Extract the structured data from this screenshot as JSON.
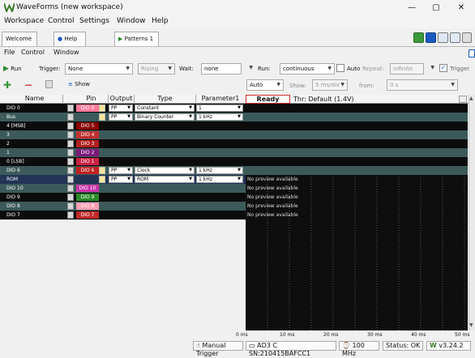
{
  "window": {
    "title": "WaveForms (new workspace)",
    "min": "—",
    "max": "▢",
    "close": "✕"
  },
  "menubar": [
    "Workspace",
    "Control",
    "Settings",
    "Window",
    "Help"
  ],
  "tabs": {
    "welcome": "Welcome",
    "help": "Help",
    "patterns": "Patterns 1"
  },
  "submenu": [
    "File",
    "Control",
    "Window"
  ],
  "toolbar": {
    "run": "Run",
    "trigger_label": "Trigger:",
    "trigger_value": "None",
    "edge": "Rising",
    "wait_label": "Wait:",
    "wait_value": "none",
    "run_label": "Run:",
    "run_value": "continuous",
    "auto_label": "Auto",
    "repeat_label": "Repeat:",
    "repeat_value": "infinite",
    "trigger_check": "Trigger"
  },
  "toolbar2": {
    "show": "Show",
    "auto": "Auto",
    "show_label": "Show:",
    "show_value": "5 ms/div",
    "from_label": "from:",
    "from_value": "0 s"
  },
  "columns": [
    "Name",
    "Pin",
    "Output",
    "Type",
    "Parameter1"
  ],
  "status": {
    "ready": "Ready",
    "thr": "Thr: Default (1.4V)"
  },
  "rows": [
    {
      "name": "DIO 0",
      "pin": "DIO 0",
      "output": "PP",
      "type": "Constant",
      "param": "1",
      "preview": "",
      "bg": "#0c0c0c",
      "pinColor": "#ff7a9a"
    },
    {
      "name": "Bus",
      "pin": "",
      "output": "PP",
      "type": "Binary Counter",
      "param": "1 kHz",
      "preview": "",
      "bg": "#3c5a5a",
      "pinColor": ""
    },
    {
      "name": "4 [MSB]",
      "pin": "DIO 5",
      "output": "",
      "type": "",
      "param": "",
      "preview": "",
      "bg": "#0c0c0c",
      "pinColor": "#8b0000"
    },
    {
      "name": "3",
      "pin": "DIO 4",
      "output": "",
      "type": "",
      "param": "",
      "preview": "",
      "bg": "#3c5a5a",
      "pinColor": "#c03030"
    },
    {
      "name": "2",
      "pin": "DIO 3",
      "output": "",
      "type": "",
      "param": "",
      "preview": "",
      "bg": "#0c0c0c",
      "pinColor": "#b02020"
    },
    {
      "name": "1",
      "pin": "DIO 2",
      "output": "",
      "type": "",
      "param": "",
      "preview": "",
      "bg": "#3c5a5a",
      "pinColor": "#7a1a7a"
    },
    {
      "name": "0 [LSB]",
      "pin": "DIO 1",
      "output": "",
      "type": "",
      "param": "",
      "preview": "",
      "bg": "#0c0c0c",
      "pinColor": "#cc2244"
    },
    {
      "name": "DIO 6",
      "pin": "DIO 6",
      "output": "PP",
      "type": "Clock",
      "param": "1 kHz",
      "preview": "",
      "bg": "#3c5a5a",
      "pinColor": "#c02020"
    },
    {
      "name": "ROM",
      "pin": "",
      "output": "PP",
      "type": "ROM",
      "param": "1 kHz",
      "preview": "No preview available",
      "bg": "#223355",
      "pinColor": ""
    },
    {
      "name": "DIO 10",
      "pin": "DIO 10",
      "output": "",
      "type": "",
      "param": "",
      "preview": "No preview available",
      "bg": "#3c5a5a",
      "pinColor": "#cc33aa"
    },
    {
      "name": "DIO 9",
      "pin": "DIO 9",
      "output": "",
      "type": "",
      "param": "",
      "preview": "No preview available",
      "bg": "#0c0c0c",
      "pinColor": "#2a8a2a"
    },
    {
      "name": "DIO 8",
      "pin": "DIO 8",
      "output": "",
      "type": "",
      "param": "",
      "preview": "No preview available",
      "bg": "#3c5a5a",
      "pinColor": "#ff9fb4"
    },
    {
      "name": "DIO 7",
      "pin": "DIO 7",
      "output": "",
      "type": "",
      "param": "",
      "preview": "No preview available",
      "bg": "#0c0c0c",
      "pinColor": "#c02a2a"
    }
  ],
  "time_ticks": [
    "0 ms",
    "10 ms",
    "20 ms",
    "30 ms",
    "40 ms",
    "50 ms"
  ],
  "statusbar": {
    "manual": "Manual Trigger",
    "device": "AD3 C SN:210415BAFCC1",
    "freq": "100 MHz",
    "status": "Status: OK",
    "version": "v3.24.2"
  }
}
